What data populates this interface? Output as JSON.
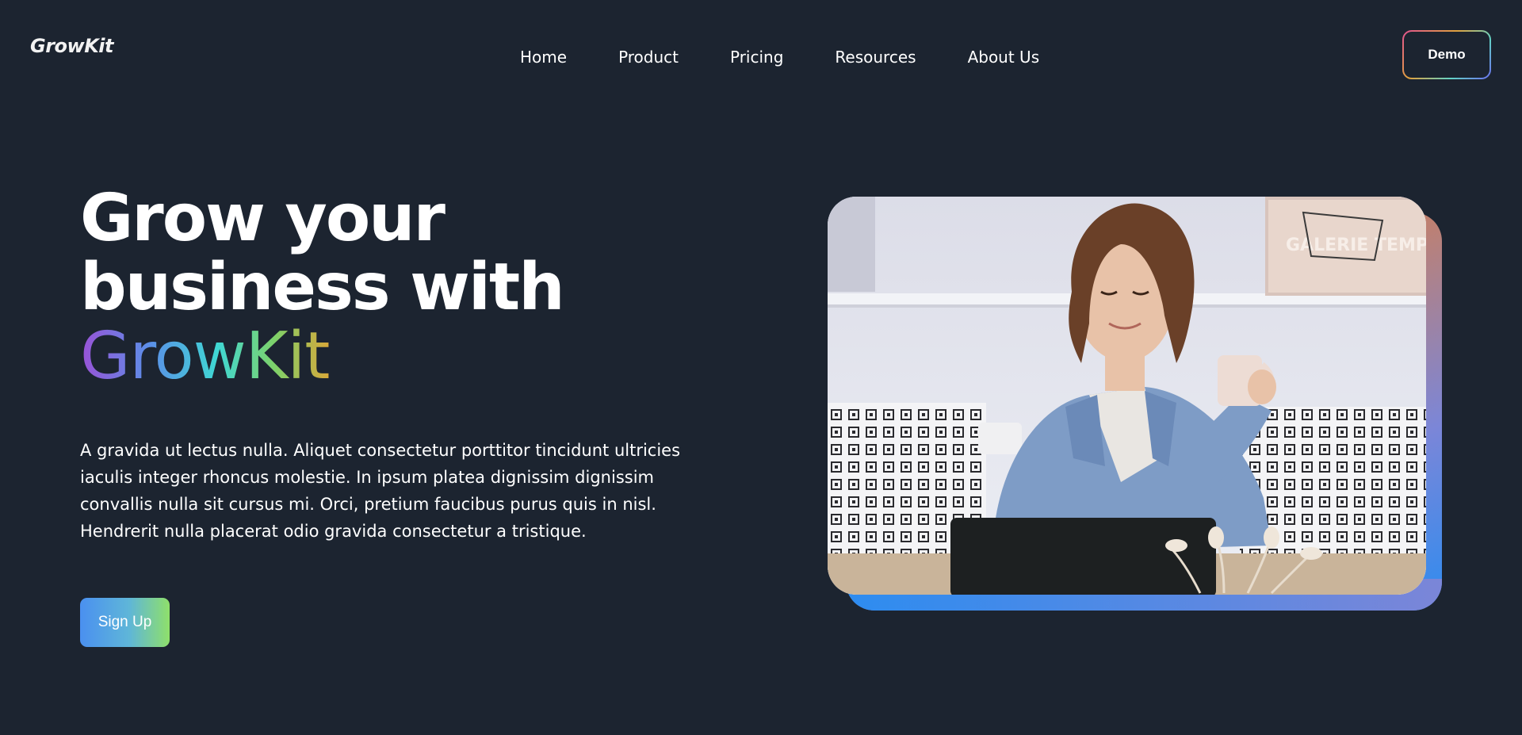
{
  "header": {
    "logo": "GrowKit",
    "nav": [
      "Home",
      "Product",
      "Pricing",
      "Resources",
      "About Us"
    ],
    "demo_label": "Demo"
  },
  "hero": {
    "headline_line1": "Grow your",
    "headline_line2": "business with",
    "headline_brand": "GrowKit",
    "body": "A gravida ut lectus nulla. Aliquet consectetur porttitor tincidunt ultricies iaculis integer rhoncus molestie. In ipsum platea dignissim dignissim convallis nulla sit cursus mi. Orci, pretium faucibus purus quis in nisl. Hendrerit nulla placerat odio gravida consectetur a tristique.",
    "signup_label": "Sign Up",
    "poster_text": "GALERIE TEMPO"
  },
  "colors": {
    "background": "#1c2430",
    "signup_gradient": [
      "#4a90f0",
      "#8fe06a"
    ],
    "image_frame_gradient": [
      "#f08428",
      "#2d8cf0"
    ]
  }
}
